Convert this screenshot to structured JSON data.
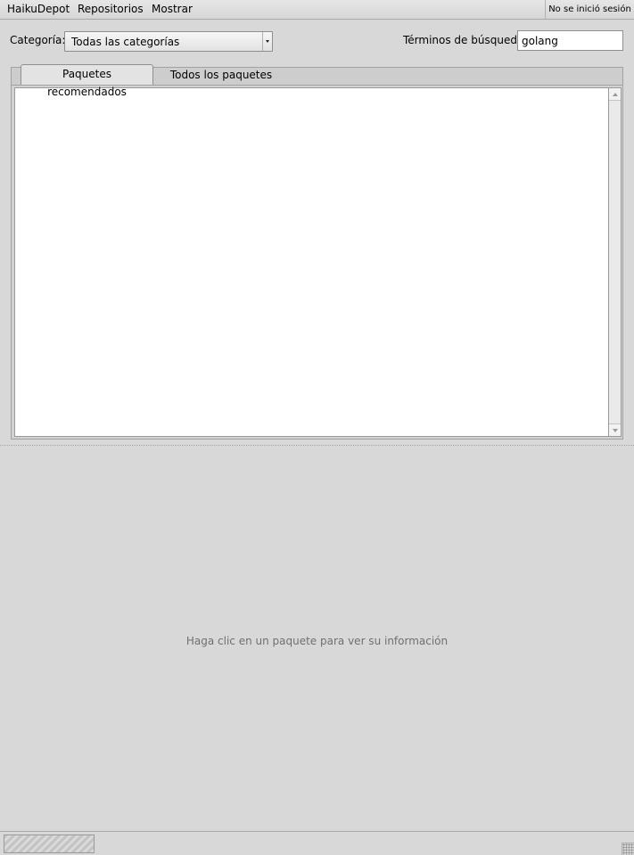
{
  "menubar": {
    "items": [
      "HaikuDepot",
      "Repositorios",
      "Mostrar"
    ],
    "login_status": "No se inició sesión"
  },
  "filters": {
    "category_label": "Categoría:",
    "category_selected": "Todas las categorías",
    "search_label": "Términos de búsqueda",
    "search_value": "golang"
  },
  "tabs": [
    {
      "label": "Paquetes recomendados",
      "active": true
    },
    {
      "label": "Todos los paquetes",
      "active": false
    }
  ],
  "info": {
    "empty_message": "Haga clic en un paquete para ver su información"
  },
  "status": {
    "progress": 0
  },
  "colors": {
    "window_bg": "#d8d8d8",
    "list_bg": "#ffffff",
    "hint_text": "#707070"
  }
}
